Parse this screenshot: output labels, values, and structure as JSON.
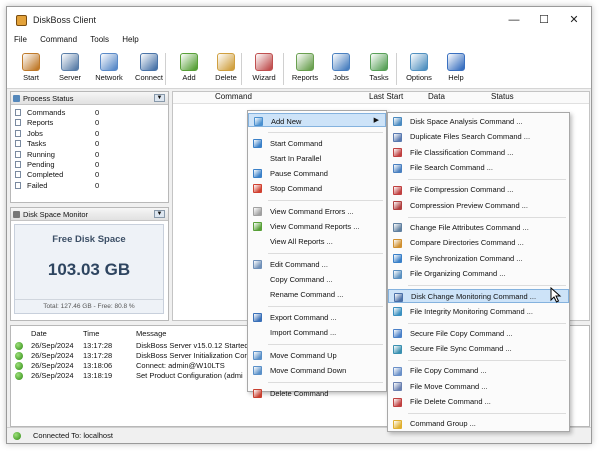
{
  "window": {
    "title": "DiskBoss Client",
    "minimize": "—",
    "maximize": "☐",
    "close": "✕"
  },
  "menubar": [
    "File",
    "Command",
    "Tools",
    "Help"
  ],
  "toolbar": [
    {
      "label": "Start",
      "icon": "start-icon",
      "color": "#c07a2a"
    },
    {
      "label": "Server",
      "icon": "server-icon",
      "color": "#5a7ea8"
    },
    {
      "label": "Network",
      "icon": "network-icon",
      "color": "#5a8ac8"
    },
    {
      "label": "Connect",
      "icon": "connect-icon",
      "color": "#4a74a8"
    },
    {
      "label": "Add",
      "icon": "add-icon",
      "color": "#58a038"
    },
    {
      "label": "Delete",
      "icon": "delete-icon",
      "color": "#d0a040"
    },
    {
      "label": "Wizard",
      "icon": "wizard-icon",
      "color": "#c05050"
    },
    {
      "label": "Reports",
      "icon": "reports-icon",
      "color": "#6aa050"
    },
    {
      "label": "Jobs",
      "icon": "jobs-icon",
      "color": "#4a80c0"
    },
    {
      "label": "Tasks",
      "icon": "tasks-icon",
      "color": "#58a058"
    },
    {
      "label": "Options",
      "icon": "options-icon",
      "color": "#5090c0"
    },
    {
      "label": "Help",
      "icon": "help-icon",
      "color": "#3a70c0"
    }
  ],
  "process_status": {
    "title": "Process Status",
    "rows": [
      {
        "label": "Commands",
        "value": "0"
      },
      {
        "label": "Reports",
        "value": "0"
      },
      {
        "label": "Jobs",
        "value": "0"
      },
      {
        "label": "Tasks",
        "value": "0"
      },
      {
        "label": "Running",
        "value": "0"
      },
      {
        "label": "Pending",
        "value": "0"
      },
      {
        "label": "Completed",
        "value": "0"
      },
      {
        "label": "Failed",
        "value": "0"
      }
    ]
  },
  "disk_monitor": {
    "title": "Disk Space Monitor",
    "heading": "Free Disk Space",
    "value": "103.03 GB",
    "footer": "Total: 127.46 GB - Free: 80.8 %"
  },
  "command_table": {
    "columns": [
      "Command",
      "Last Start",
      "Data",
      "Status"
    ]
  },
  "log": {
    "columns": [
      "Date",
      "Time",
      "Message"
    ],
    "rows": [
      {
        "date": "26/Sep/2024",
        "time": "13:17:28",
        "message": "DiskBoss Server v15.0.12 Started o"
      },
      {
        "date": "26/Sep/2024",
        "time": "13:17:28",
        "message": "DiskBoss Server Initialization Cor"
      },
      {
        "date": "26/Sep/2024",
        "time": "13:18:06",
        "message": "Connect: admin@W10LTS"
      },
      {
        "date": "26/Sep/2024",
        "time": "13:18:19",
        "message": "Set Product Configuration (admi"
      }
    ]
  },
  "statusbar": {
    "text": "Connected To: localhost"
  },
  "context_menu": {
    "items": [
      {
        "label": "Add New",
        "icon": "add-new-icon",
        "color": "#4a90d0",
        "highlight": true,
        "submenu": true
      },
      {
        "sep": true
      },
      {
        "label": "Start Command",
        "icon": "start-command-icon",
        "color": "#3a80c8"
      },
      {
        "label": "Start In Parallel",
        "icon": "",
        "color": ""
      },
      {
        "label": "Pause Command",
        "icon": "pause-icon",
        "color": "#3a80c8"
      },
      {
        "label": "Stop Command",
        "icon": "stop-icon",
        "color": "#d04030"
      },
      {
        "sep": true
      },
      {
        "label": "View Command Errors ...",
        "icon": "errors-icon",
        "color": "#a0a0a0"
      },
      {
        "label": "View Command Reports ...",
        "icon": "reports-icon",
        "color": "#58a038"
      },
      {
        "label": "View All Reports ...",
        "icon": "",
        "color": ""
      },
      {
        "sep": true
      },
      {
        "label": "Edit Command ...",
        "icon": "edit-icon",
        "color": "#7090b8"
      },
      {
        "label": "Copy Command ...",
        "icon": "",
        "color": ""
      },
      {
        "label": "Rename Command ...",
        "icon": "",
        "color": ""
      },
      {
        "sep": true
      },
      {
        "label": "Export Command ...",
        "icon": "export-icon",
        "color": "#3a70b8"
      },
      {
        "label": "Import Command ...",
        "icon": "",
        "color": ""
      },
      {
        "sep": true
      },
      {
        "label": "Move Command Up",
        "icon": "up-icon",
        "color": "#5a90c8"
      },
      {
        "label": "Move Command Down",
        "icon": "down-icon",
        "color": "#5a90c8"
      },
      {
        "sep": true
      },
      {
        "label": "Delete Command",
        "icon": "delete-icon",
        "color": "#c84030"
      }
    ]
  },
  "submenu": {
    "items": [
      {
        "label": "Disk Space Analysis Command ...",
        "icon": "disk-space-icon",
        "color": "#4a8ac0"
      },
      {
        "label": "Duplicate Files Search Command ...",
        "icon": "duplicate-icon",
        "color": "#5a7ab0"
      },
      {
        "label": "File Classification Command ...",
        "icon": "classification-icon",
        "color": "#c04040"
      },
      {
        "label": "File Search Command ...",
        "icon": "search-icon",
        "color": "#4a80c0"
      },
      {
        "sep": true
      },
      {
        "label": "File Compression Command ...",
        "icon": "compression-icon",
        "color": "#c04040"
      },
      {
        "label": "Compression Preview Command ...",
        "icon": "preview-icon",
        "color": "#b04040"
      },
      {
        "sep": true
      },
      {
        "label": "Change File Attributes Command ...",
        "icon": "attributes-icon",
        "color": "#6080a0"
      },
      {
        "label": "Compare Directories Command ...",
        "icon": "compare-icon",
        "color": "#d09030"
      },
      {
        "label": "File Synchronization Command ...",
        "icon": "sync-icon",
        "color": "#3a80c8"
      },
      {
        "label": "File Organizing Command ...",
        "icon": "organize-icon",
        "color": "#5a90c0"
      },
      {
        "sep": true
      },
      {
        "label": "Disk Change Monitoring Command ...",
        "icon": "monitoring-icon",
        "color": "#4a70a8",
        "highlight": true
      },
      {
        "label": "File Integrity Monitoring Command ...",
        "icon": "integrity-icon",
        "color": "#3a90c0"
      },
      {
        "sep": true
      },
      {
        "label": "Secure File Copy Command ...",
        "icon": "secure-copy-icon",
        "color": "#4a80c8"
      },
      {
        "label": "Secure File Sync Command ...",
        "icon": "secure-sync-icon",
        "color": "#3a90b0"
      },
      {
        "sep": true
      },
      {
        "label": "File Copy Command ...",
        "icon": "copy-icon",
        "color": "#6a90c8"
      },
      {
        "label": "File Move Command ...",
        "icon": "move-icon",
        "color": "#6a80b0"
      },
      {
        "label": "File Delete Command ...",
        "icon": "file-delete-icon",
        "color": "#c04040"
      },
      {
        "sep": true
      },
      {
        "label": "Command Group ...",
        "icon": "group-icon",
        "color": "#e0b030"
      }
    ]
  }
}
